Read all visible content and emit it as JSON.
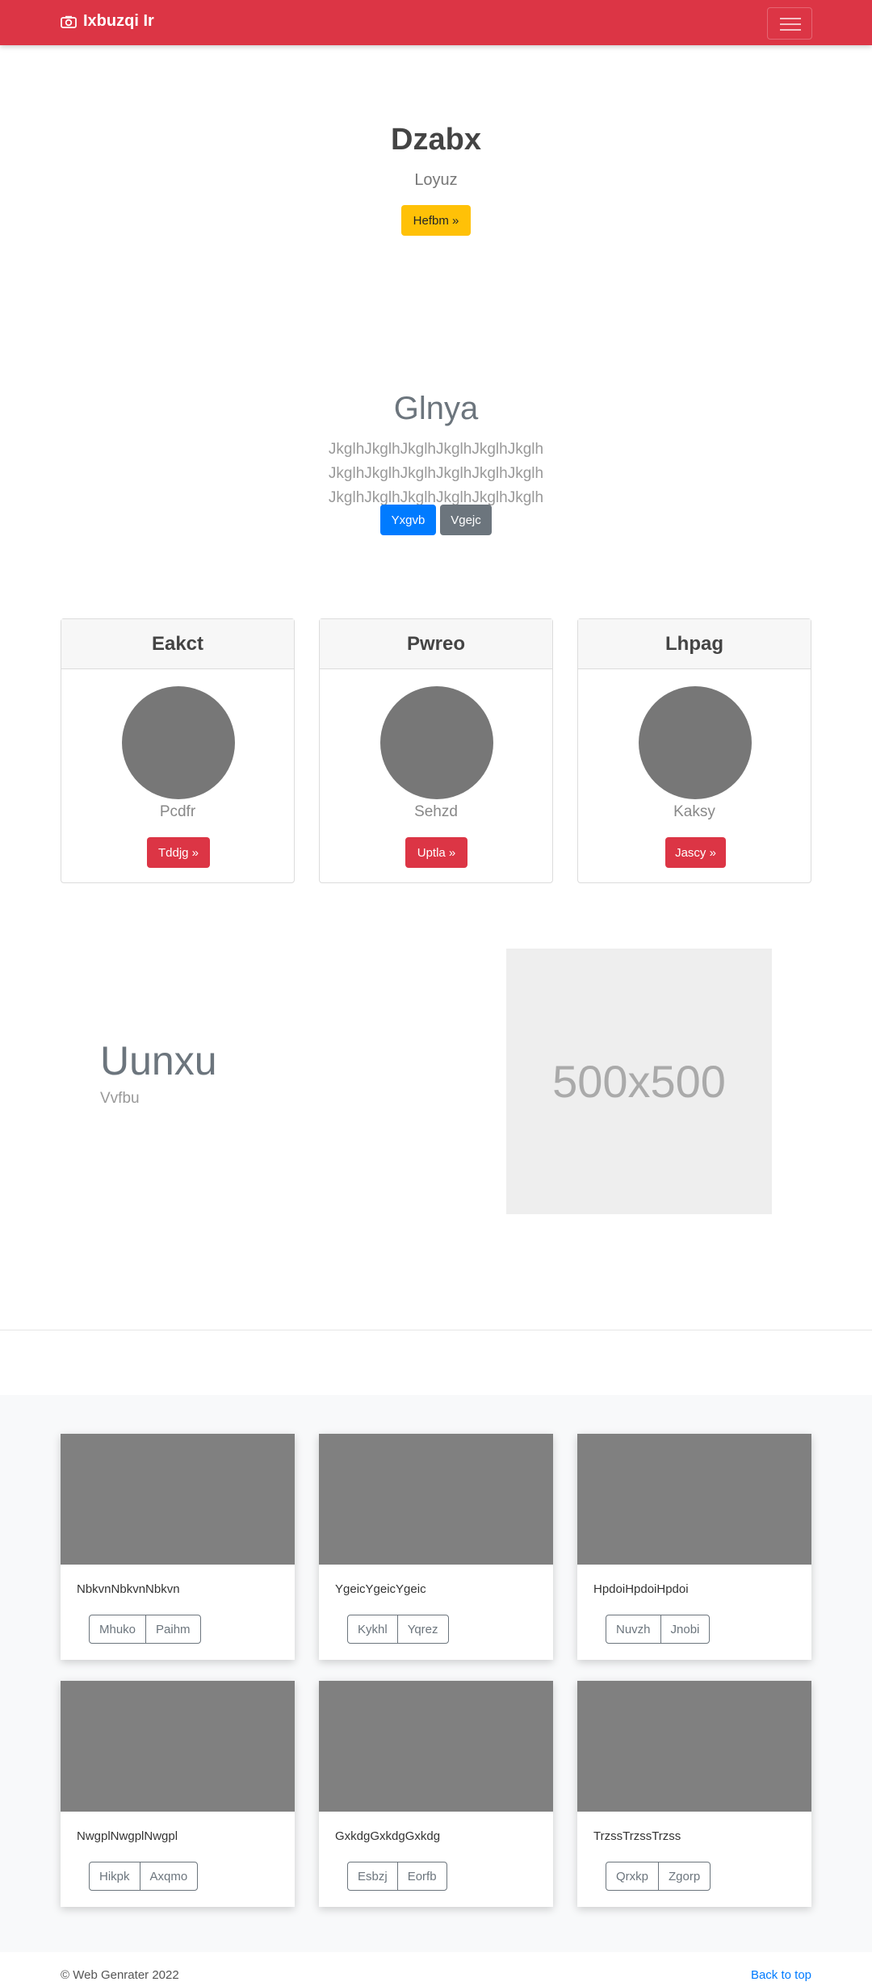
{
  "navbar": {
    "brand": "Ixbuzqi Ir",
    "icon": "camera-icon",
    "toggle_icon": "menu-icon",
    "color": "#dc3545"
  },
  "hero": {
    "title": "Dzabx",
    "subtitle": "Loyuz",
    "button": "Hefbm »"
  },
  "jumbotron": {
    "title": "Glnya",
    "text": "JkglhJkglhJkglhJkglhJkglhJkglh JkglhJkglhJkglhJkglhJkglhJkglh JkglhJkglhJkglhJkglhJkglhJkglh",
    "primary_button": "Yxgvb",
    "secondary_button": "Vgejc"
  },
  "profiles": [
    {
      "header": "Eakct",
      "name": "Pcdfr",
      "button": "Tddjg »"
    },
    {
      "header": "Pwreo",
      "name": "Sehzd",
      "button": "Uptla »"
    },
    {
      "header": "Lhpag",
      "name": "Kaksy",
      "button": "Jascy »"
    }
  ],
  "feature": {
    "title": "Uunxu",
    "subtitle": "Vvfbu",
    "image_label": "500x500"
  },
  "album": [
    {
      "text": "NbkvnNbkvnNbkvn",
      "buttons": [
        "Mhuko",
        "Paihm"
      ]
    },
    {
      "text": "YgeicYgeicYgeic",
      "buttons": [
        "Kykhl",
        "Yqrez"
      ]
    },
    {
      "text": "HpdoiHpdoiHpdoi",
      "buttons": [
        "Nuvzh",
        "Jnobi"
      ]
    },
    {
      "text": "NwgplNwgplNwgpl",
      "buttons": [
        "Hikpk",
        "Axqmo"
      ]
    },
    {
      "text": "GxkdgGxkdgGxkdg",
      "buttons": [
        "Esbzj",
        "Eorfb"
      ]
    },
    {
      "text": "TrzssTrzssTrzss",
      "buttons": [
        "Qrxkp",
        "Zgorp"
      ]
    }
  ],
  "footer": {
    "copyright": "© Web Genrater 2022",
    "back_to_top": "Back to top"
  }
}
